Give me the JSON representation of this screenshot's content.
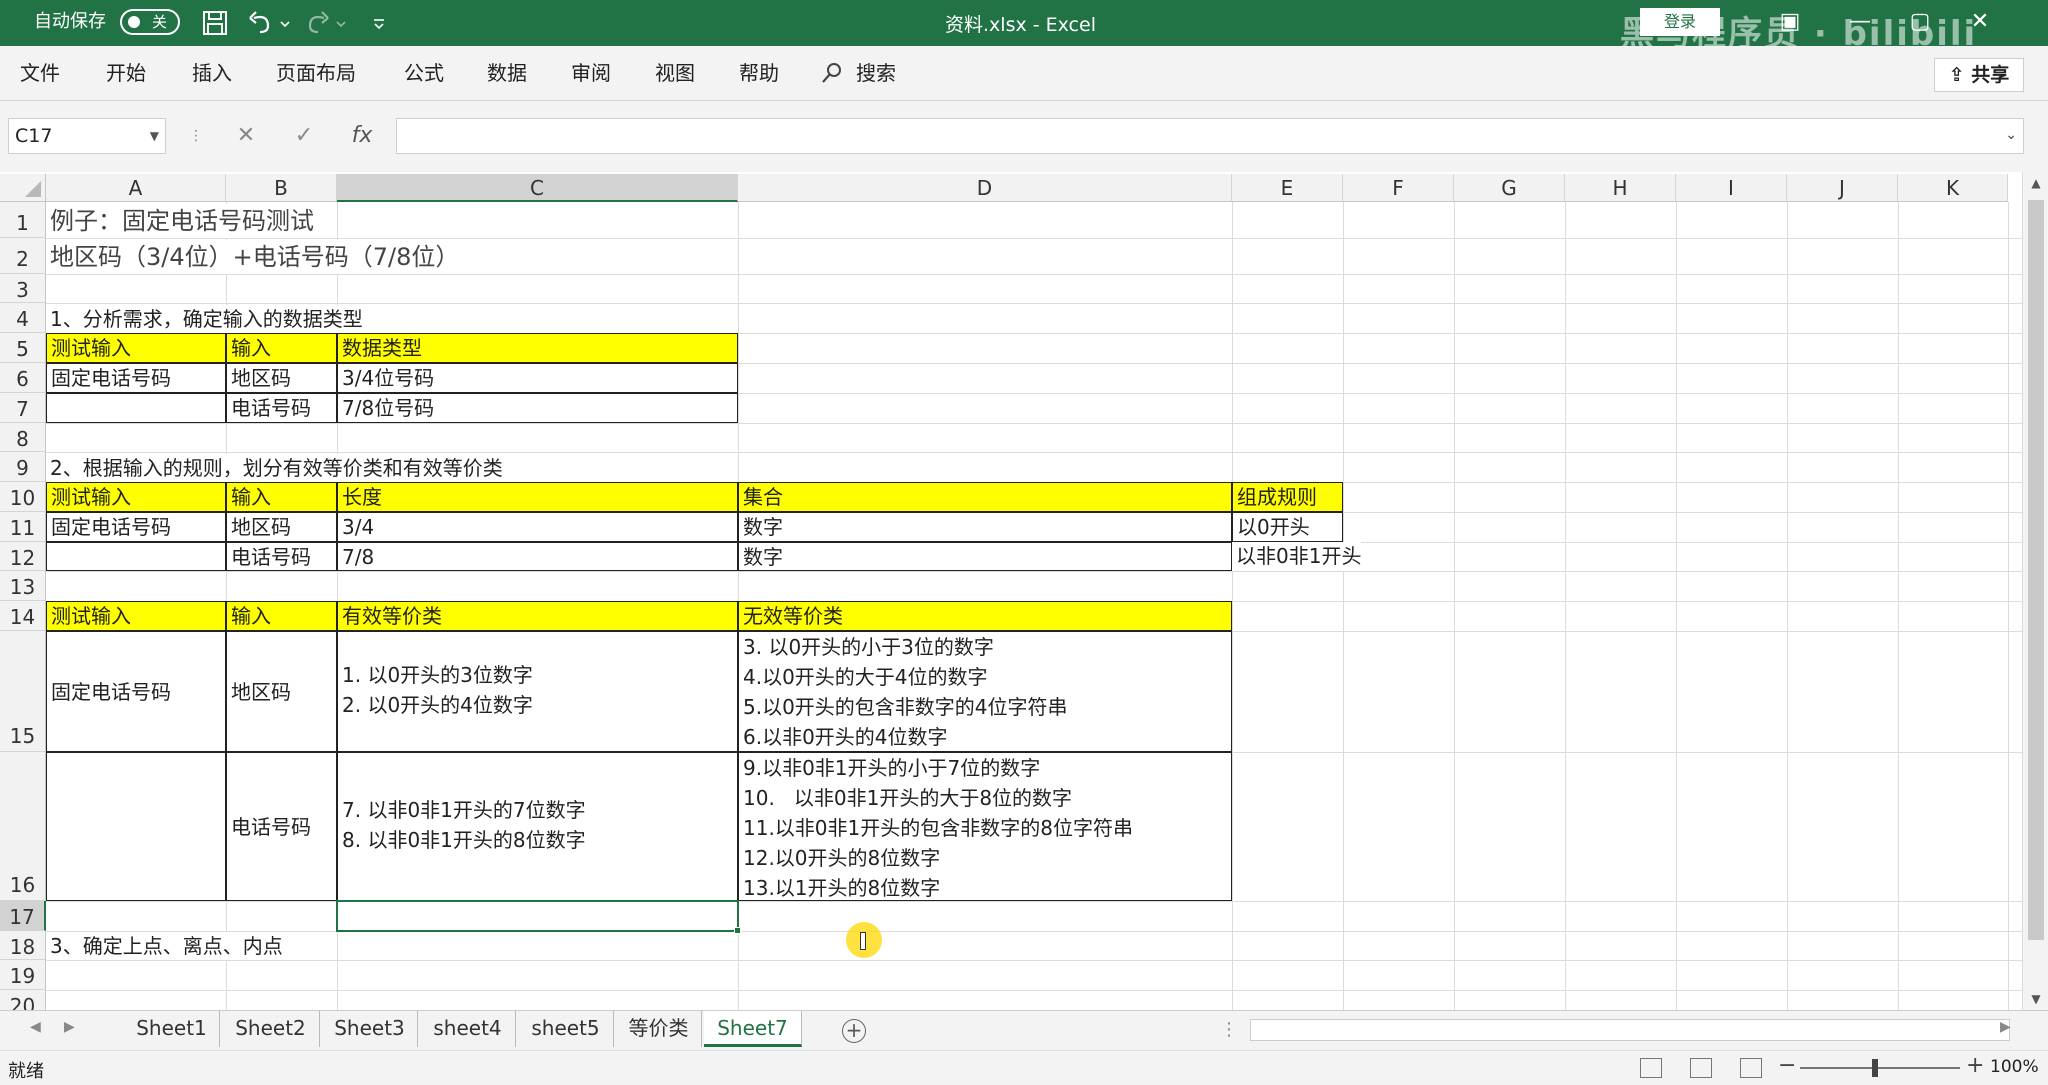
{
  "titlebar": {
    "autosave_label": "自动保存",
    "autosave_state": "关",
    "doc_title": "资料.xlsx  -  Excel",
    "login_label": "登录",
    "watermark": "黑马程序员 · bilibili"
  },
  "ribbon": {
    "tabs": [
      "文件",
      "开始",
      "插入",
      "页面布局",
      "公式",
      "数据",
      "审阅",
      "视图",
      "帮助"
    ],
    "search_label": "搜索",
    "share_label": "共享"
  },
  "formula_bar": {
    "name_box": "C17",
    "fx_label": "fx",
    "formula": ""
  },
  "sheet": {
    "columns": [
      "A",
      "B",
      "C",
      "D",
      "E",
      "F",
      "G",
      "H",
      "I",
      "J",
      "K"
    ],
    "selected_column": "C",
    "rows": [
      "1",
      "2",
      "3",
      "4",
      "5",
      "6",
      "7",
      "8",
      "9",
      "10",
      "11",
      "12",
      "13",
      "14",
      "15",
      "16",
      "17",
      "18",
      "19",
      "20"
    ],
    "selected_row": "17",
    "r1": "例子：固定电话号码测试",
    "r2": "地区码（3/4位）+电话号码（7/8位）",
    "r4": "1、分析需求，确定输入的数据类型",
    "t1": {
      "h": [
        "测试输入",
        "输入",
        "数据类型"
      ],
      "r6": [
        "固定电话号码",
        "地区码",
        "3/4位号码"
      ],
      "r7": [
        "",
        "电话号码",
        "7/8位号码"
      ]
    },
    "r9": "2、根据输入的规则，划分有效等价类和有效等价类",
    "t2": {
      "h": [
        "测试输入",
        "输入",
        "长度",
        "集合",
        "组成规则"
      ],
      "r11": [
        "固定电话号码",
        "地区码",
        "3/4",
        "数字",
        "以0开头"
      ],
      "r12": [
        "",
        "电话号码",
        "7/8",
        "数字",
        "以非0非1开头"
      ]
    },
    "t3": {
      "h": [
        "测试输入",
        "输入",
        "有效等价类",
        "无效等价类"
      ],
      "r15_a": "固定电话号码",
      "r15_b": "地区码",
      "r15_c": "1. 以0开头的3位数字\n2. 以0开头的4位数字",
      "r15_d": "3. 以0开头的小于3位的数字\n4.以0开头的大于4位的数字\n5.以0开头的包含非数字的4位字符串\n6.以非0开头的4位数字",
      "r16_b": "电话号码",
      "r16_c": "7. 以非0非1开头的7位数字\n8. 以非0非1开头的8位数字",
      "r16_d": "9.以非0非1开头的小于7位的数字\n10.   以非0非1开头的大于8位的数字\n11.以非0非1开头的包含非数字的8位字符串\n12.以0开头的8位数字\n13.以1开头的8位数字"
    },
    "r18": "3、确定上点、离点、内点"
  },
  "sheet_tabs": [
    "Sheet1",
    "Sheet2",
    "Sheet3",
    "sheet4",
    "sheet5",
    "等价类",
    "Sheet7"
  ],
  "active_sheet": "Sheet7",
  "status": {
    "ready": "就绪",
    "zoom": "100%"
  },
  "colors": {
    "excel_green": "#217346",
    "header_fill": "#ffff00"
  }
}
